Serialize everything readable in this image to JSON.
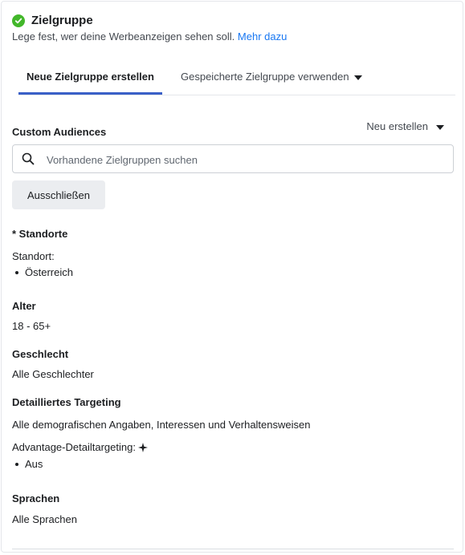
{
  "header": {
    "title": "Zielgruppe",
    "subtitle": "Lege fest, wer deine Werbeanzeigen sehen soll.",
    "link": "Mehr dazu"
  },
  "tabs": [
    {
      "label": "Neue Zielgruppe erstellen",
      "active": true
    },
    {
      "label": "Gespeicherte Zielgruppe verwenden",
      "active": false
    }
  ],
  "custom_audiences": {
    "label": "Custom Audiences",
    "new_button": "Neu erstellen",
    "search_placeholder": "Vorhandene Zielgruppen suchen",
    "exclude_button": "Ausschließen"
  },
  "locations": {
    "label": "* Standorte",
    "sub_label": "Standort:",
    "items": [
      "Österreich"
    ]
  },
  "age": {
    "label": "Alter",
    "value": "18 - 65+"
  },
  "gender": {
    "label": "Geschlecht",
    "value": "Alle Geschlechter"
  },
  "detailed_targeting": {
    "label": "Detailliertes Targeting",
    "value": "Alle demografischen Angaben, Interessen und Verhaltensweisen",
    "advantage_label": "Advantage-Detailtargeting:",
    "advantage_items": [
      "Aus"
    ]
  },
  "languages": {
    "label": "Sprachen",
    "value": "Alle Sprachen"
  },
  "colors": {
    "accent": "#1877f2",
    "check": "#42b72a",
    "tab_underline": "#3a5fc7"
  }
}
